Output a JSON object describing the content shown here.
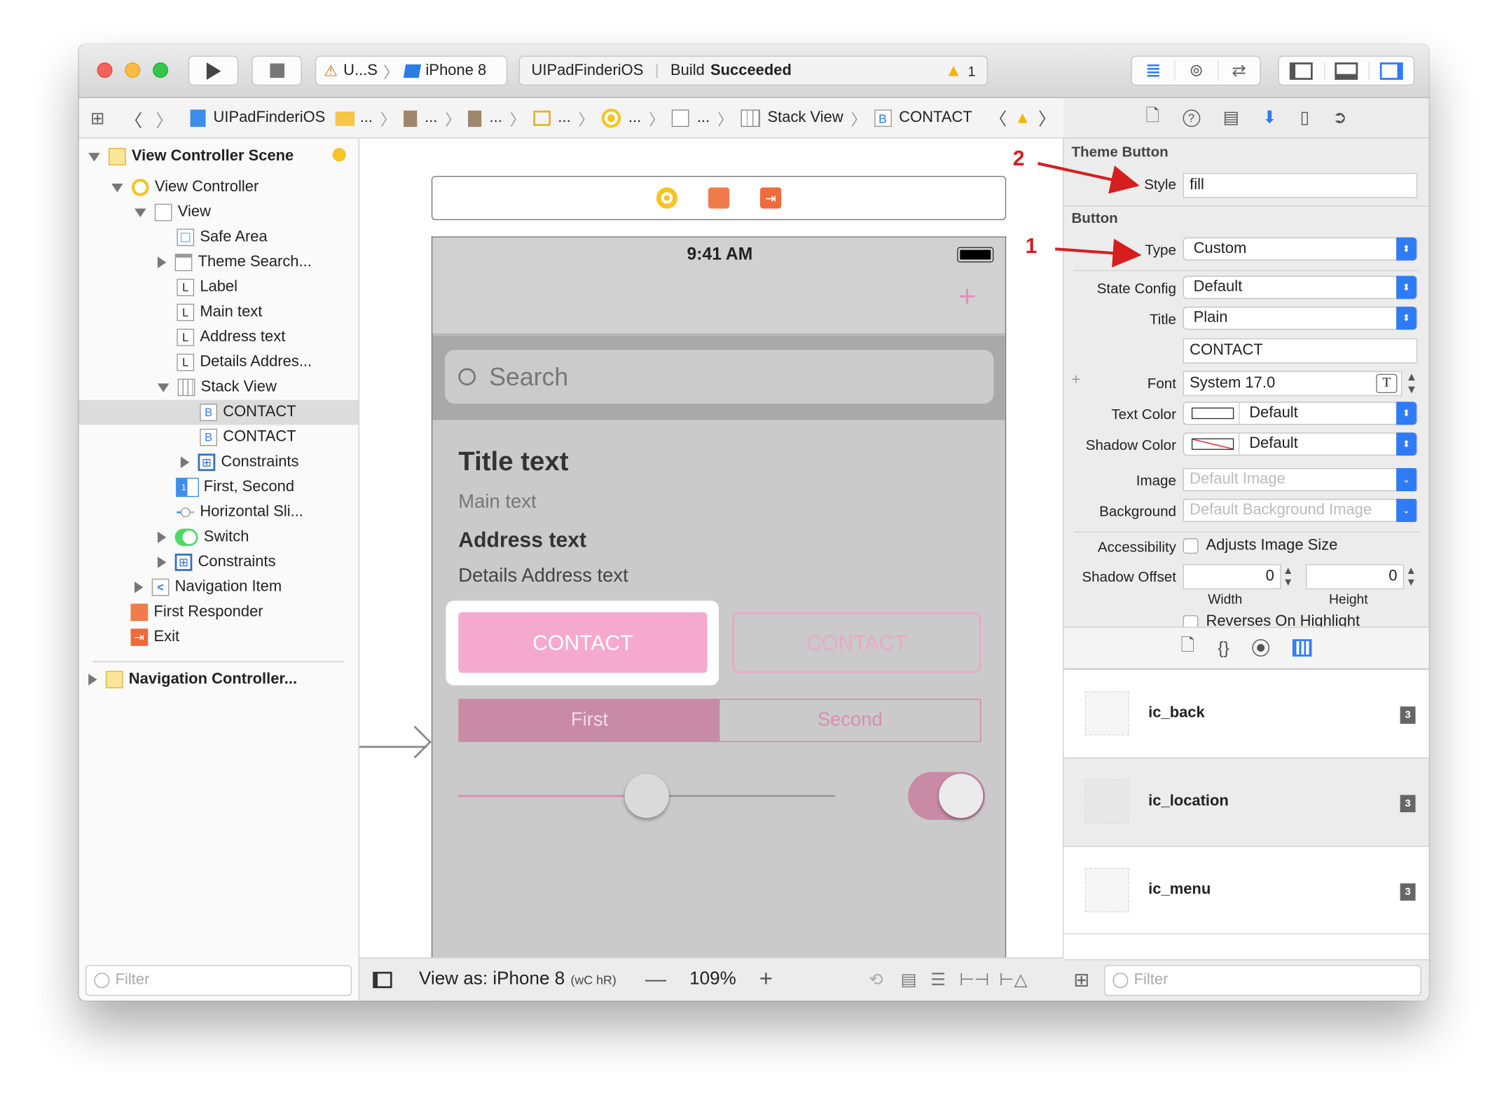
{
  "toolbar": {
    "scheme": "U...S",
    "device": "iPhone 8",
    "project": "UIPadFinderiOS",
    "build_prefix": "Build",
    "build_status": "Succeeded",
    "warning_count": "1"
  },
  "jumpbar": {
    "items": [
      "UIPadFinderiOS",
      "...",
      "...",
      "...",
      "...",
      "...",
      "...",
      "Stack View",
      "CONTACT"
    ]
  },
  "navigator": {
    "scene": "View Controller Scene",
    "items": [
      "View Controller",
      "View",
      "Safe Area",
      "Theme Search...",
      "Label",
      "Main text",
      "Address text",
      "Details Addres...",
      "Stack View",
      "CONTACT",
      "CONTACT",
      "Constraints",
      "First, Second",
      "Horizontal Sli...",
      "Switch",
      "Constraints",
      "Navigation Item",
      "First Responder",
      "Exit"
    ],
    "nav_controller": "Navigation Controller...",
    "filter_placeholder": "Filter"
  },
  "phone": {
    "time": "9:41 AM",
    "search_placeholder": "Search",
    "title": "Title text",
    "main": "Main text",
    "address": "Address text",
    "details": "Details Address text",
    "contact_fill": "CONTACT",
    "contact_outline": "CONTACT",
    "seg_first": "First",
    "seg_second": "Second",
    "slider_value": 0.5,
    "switch_on": true
  },
  "bottom_bar": {
    "view_as": "View as: iPhone 8",
    "size_class": "wC hR",
    "zoom": "109%"
  },
  "inspector": {
    "theme_section": "Theme Button",
    "style_label": "Style",
    "style_value": "fill",
    "button_section": "Button",
    "type_label": "Type",
    "type_value": "Custom",
    "state_label": "State Config",
    "state_value": "Default",
    "title_label": "Title",
    "title_value": "Plain",
    "title_text": "CONTACT",
    "font_label": "Font",
    "font_value": "System 17.0",
    "text_color_label": "Text Color",
    "text_color_value": "Default",
    "shadow_color_label": "Shadow Color",
    "shadow_color_value": "Default",
    "image_label": "Image",
    "image_placeholder": "Default Image",
    "background_label": "Background",
    "background_placeholder": "Default Background Image",
    "accessibility_label": "Accessibility",
    "adjusts_label": "Adjusts Image Size",
    "shadow_offset_label": "Shadow Offset",
    "width_value": "0",
    "height_value": "0",
    "width_label": "Width",
    "height_label": "Height",
    "reverses_label": "Reverses On Highlight"
  },
  "library": {
    "items": [
      {
        "name": "ic_back",
        "badge": "3"
      },
      {
        "name": "ic_location",
        "badge": "3"
      },
      {
        "name": "ic_menu",
        "badge": "3"
      }
    ],
    "filter_placeholder": "Filter"
  },
  "annotations": {
    "one": "1",
    "two": "2"
  },
  "colors": {
    "accent": "#2f7bf5",
    "pink": "#f5a9cf",
    "arrow": "#d61e1e"
  }
}
